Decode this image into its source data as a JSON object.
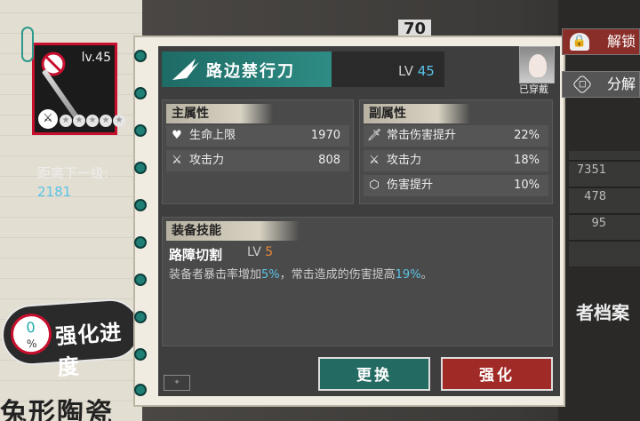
{
  "item": {
    "level": "lv.45",
    "next_level_label": "距离下一级:",
    "next_level_value": "2181",
    "progress_percent": "0",
    "progress_sign": "%",
    "progress_label": "强化进度",
    "star_count": 5
  },
  "weapon": {
    "name": "路边禁行刀",
    "lv_prefix": "LV",
    "lv_value": "45",
    "equipped_label": "已穿戴"
  },
  "main_attr": {
    "title": "主属性",
    "rows": [
      {
        "icon": "heart-icon",
        "label": "生命上限",
        "value": "1970"
      },
      {
        "icon": "crossed-swords-icon",
        "label": "攻击力",
        "value": "808"
      }
    ]
  },
  "sub_attr": {
    "title": "副属性",
    "rows": [
      {
        "icon": "sword-icon",
        "label": "常击伤害提升",
        "value": "22%"
      },
      {
        "icon": "crossed-swords-icon",
        "label": "攻击力",
        "value": "18%"
      },
      {
        "icon": "hexagon-icon",
        "label": "伤害提升",
        "value": "10%"
      }
    ]
  },
  "skill": {
    "title": "装备技能",
    "name": "路障切割",
    "lv_prefix": "LV",
    "lv_value": "5",
    "desc_part1": "装备者暴击率增加",
    "desc_hl1": "5%",
    "desc_part2": "，常击造成的伤害提高",
    "desc_hl2": "19%",
    "desc_part3": "。"
  },
  "buttons": {
    "swap": "更换",
    "enhance": "强化",
    "unlock": "解锁",
    "decompose": "分解"
  },
  "background": {
    "bottom_left_text": "兔形陶瓷",
    "right_text": "者档案",
    "top_text": "70",
    "right_nums": [
      "7351",
      "478",
      "95"
    ]
  },
  "colors": {
    "accent_teal": "#236b62",
    "accent_red": "#a02a25",
    "highlight_blue": "#5bc4e8",
    "highlight_orange": "#e8893a"
  }
}
